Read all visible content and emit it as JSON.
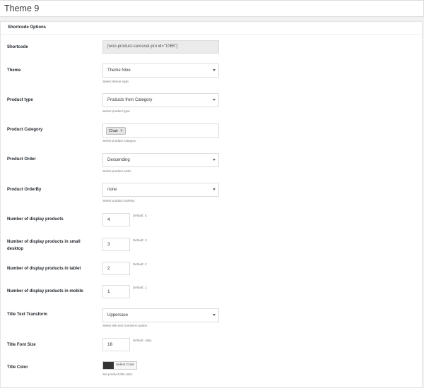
{
  "post": {
    "title": "Theme 9"
  },
  "panel": {
    "title": "Shortcode Options"
  },
  "fields": {
    "shortcode": {
      "label": "Shortcode",
      "value": "[woo-product-carousel-pro id=\"1065\"]"
    },
    "theme": {
      "label": "Theme",
      "value": "Theme Nine",
      "help": "Select theme style."
    },
    "product_type": {
      "label": "Product type",
      "value": "Products from Category",
      "help": "Select product type."
    },
    "product_category": {
      "label": "Product Category",
      "chip": "Chair",
      "chip_remove": "×",
      "help": "Select product category."
    },
    "product_order": {
      "label": "Product Order",
      "value": "Descending",
      "help": "Select product order."
    },
    "product_orderby": {
      "label": "Product OrderBy",
      "value": "none",
      "help": "Select product orderby."
    },
    "display_products": {
      "label": "Number of display products",
      "value": "4",
      "default": "Default: 4."
    },
    "display_small_desktop": {
      "label": "Number of display products in small desktop",
      "value": "3",
      "default": "Default: 3."
    },
    "display_tablet": {
      "label": "Number of display products in tablet",
      "value": "2",
      "default": "Default: 2."
    },
    "display_mobile": {
      "label": "Number of display products in mobile",
      "value": "1",
      "default": "Default: 1."
    },
    "title_transform": {
      "label": "Title Text Transform",
      "value": "Uppercase",
      "help": "Select title text transform option."
    },
    "title_font_size": {
      "label": "Title Font Size",
      "value": "16",
      "default": "Default: 18px."
    },
    "title_color": {
      "label": "Title Color",
      "button": "Select Color",
      "swatch": "#333333",
      "help": "Set product title color."
    }
  }
}
